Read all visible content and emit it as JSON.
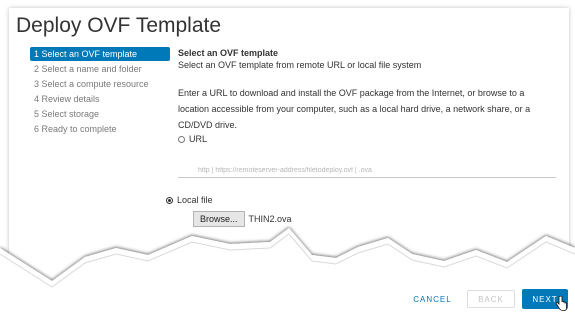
{
  "dialog": {
    "title": "Deploy OVF Template"
  },
  "steps": [
    {
      "label": "1 Select an OVF template",
      "active": true
    },
    {
      "label": "2 Select a name and folder",
      "active": false
    },
    {
      "label": "3 Select a compute resource",
      "active": false
    },
    {
      "label": "4 Review details",
      "active": false
    },
    {
      "label": "5 Select storage",
      "active": false
    },
    {
      "label": "6 Ready to complete",
      "active": false
    }
  ],
  "content": {
    "heading": "Select an OVF template",
    "subheading": "Select an OVF template from remote URL or local file system",
    "description": "Enter a URL to download and install the OVF package from the Internet, or browse to a location accessible from your computer, such as a local hard drive, a network share, or a CD/DVD drive.",
    "url_option_label": "URL",
    "url_placeholder": "http | https://remoteserver-address/filetodeploy.ovf | .ova",
    "local_option_label": "Local file",
    "browse_label": "Browse...",
    "selected_file": "THIN2.ova",
    "selected_option": "local"
  },
  "footer": {
    "cancel_label": "CANCEL",
    "back_label": "BACK",
    "next_label": "NEXT"
  },
  "colors": {
    "accent": "#0079b8",
    "text": "#333333",
    "muted": "#7a7a7a"
  }
}
